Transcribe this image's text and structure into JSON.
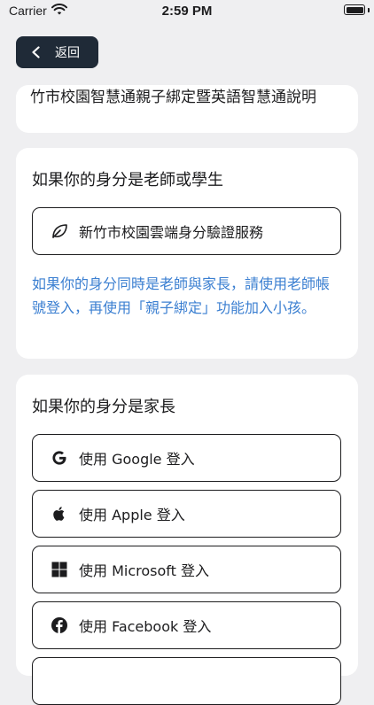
{
  "status_bar": {
    "carrier": "Carrier",
    "time": "2:59 PM"
  },
  "back_button": {
    "label": "返回"
  },
  "top_card": {
    "text": "竹市校園智慧通親子綁定暨英語智慧通說明"
  },
  "teacher_section": {
    "title": "如果你的身分是老師或學生",
    "sso_button": "新竹市校園雲端身分驗證服務",
    "hint": "如果你的身分同時是老師與家長，請使用老師帳號登入，再使用「親子綁定」功能加入小孩。"
  },
  "parent_section": {
    "title": "如果你的身分是家長",
    "buttons": [
      {
        "label": "使用 Google 登入",
        "icon": "google-icon"
      },
      {
        "label": "使用 Apple 登入",
        "icon": "apple-icon"
      },
      {
        "label": "使用 Microsoft 登入",
        "icon": "microsoft-icon"
      },
      {
        "label": "使用 Facebook 登入",
        "icon": "facebook-icon"
      }
    ]
  }
}
